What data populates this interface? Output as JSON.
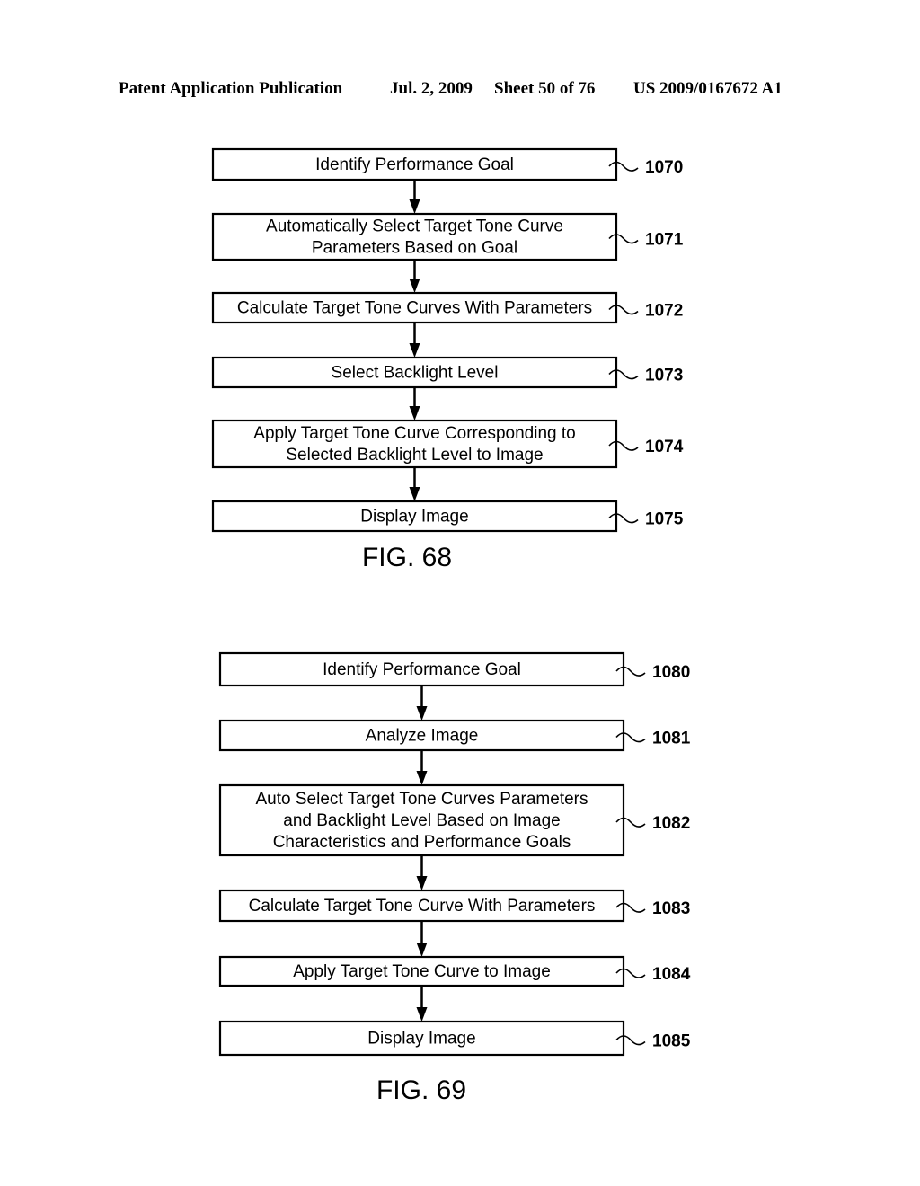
{
  "header": {
    "publication": "Patent Application Publication",
    "date": "Jul. 2, 2009",
    "sheet": "Sheet 50 of 76",
    "number": "US 2009/0167672 A1"
  },
  "figures": [
    {
      "label": "FIG. 68",
      "steps": [
        {
          "ref": "1070",
          "lines": [
            "Identify Performance Goal"
          ]
        },
        {
          "ref": "1071",
          "lines": [
            "Automatically Select Target Tone Curve",
            "Parameters Based on Goal"
          ]
        },
        {
          "ref": "1072",
          "lines": [
            "Calculate Target Tone Curves With Parameters"
          ]
        },
        {
          "ref": "1073",
          "lines": [
            "Select Backlight Level"
          ]
        },
        {
          "ref": "1074",
          "lines": [
            "Apply Target Tone Curve Corresponding to",
            "Selected Backlight Level to Image"
          ]
        },
        {
          "ref": "1075",
          "lines": [
            "Display Image"
          ]
        }
      ]
    },
    {
      "label": "FIG. 69",
      "steps": [
        {
          "ref": "1080",
          "lines": [
            "Identify Performance Goal"
          ]
        },
        {
          "ref": "1081",
          "lines": [
            "Analyze Image"
          ]
        },
        {
          "ref": "1082",
          "lines": [
            "Auto Select Target Tone Curves Parameters",
            "and Backlight Level Based on Image",
            "Characteristics and Performance Goals"
          ]
        },
        {
          "ref": "1083",
          "lines": [
            "Calculate Target Tone Curve With Parameters"
          ]
        },
        {
          "ref": "1084",
          "lines": [
            "Apply Target Tone Curve to Image"
          ]
        },
        {
          "ref": "1085",
          "lines": [
            "Display Image"
          ]
        }
      ]
    }
  ]
}
